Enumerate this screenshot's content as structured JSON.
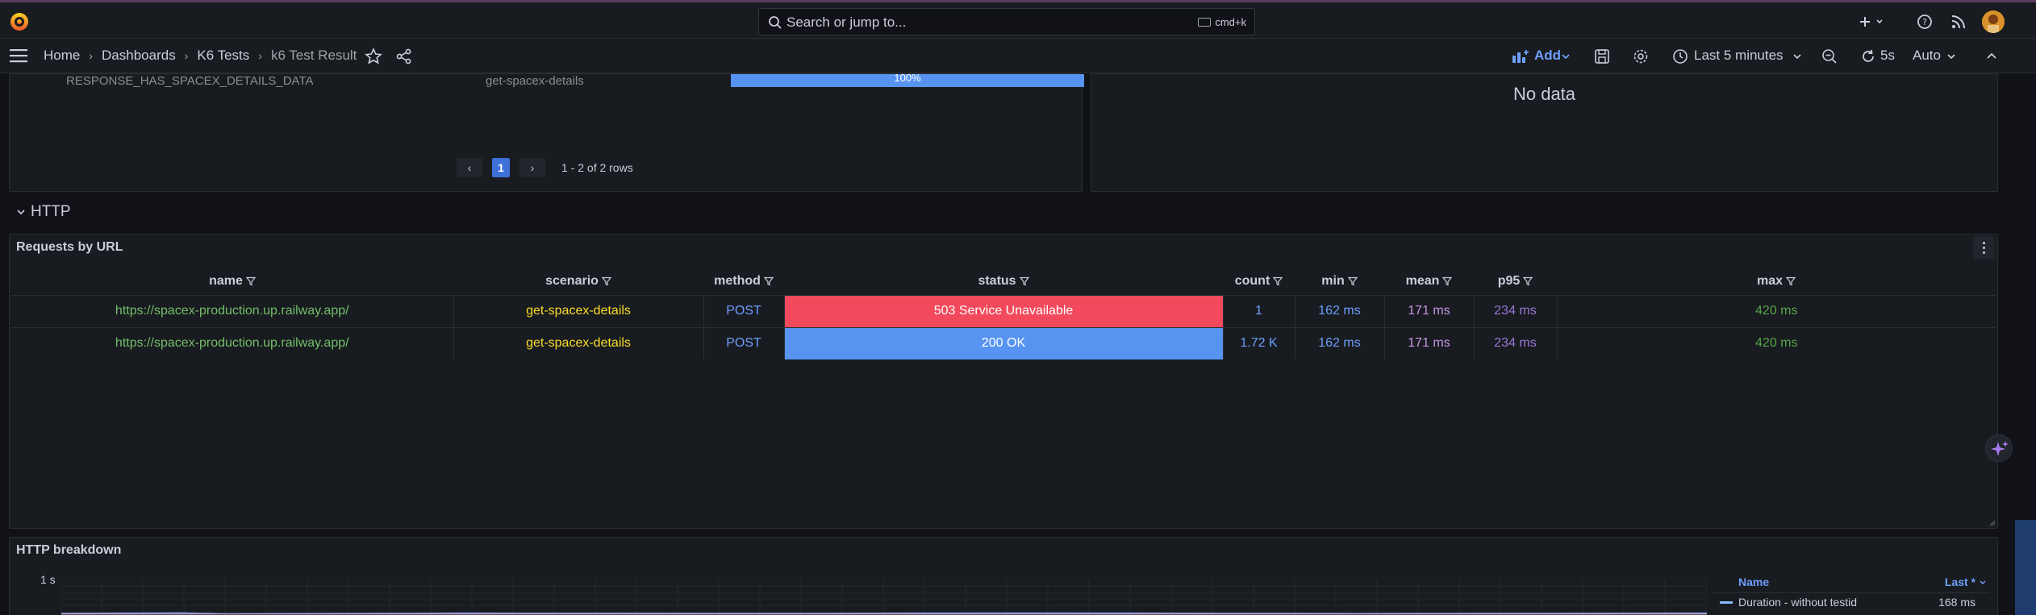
{
  "topbar": {
    "search_placeholder": "Search or jump to...",
    "search_shortcut": "cmd+k"
  },
  "nav": {
    "breadcrumbs": [
      "Home",
      "Dashboards",
      "K6 Tests",
      "k6 Test Result"
    ],
    "add_label": "Add",
    "time_range": "Last 5 minutes",
    "refresh_interval": "5s",
    "mode": "Auto"
  },
  "top_panels": {
    "cutoff_row_left": "RESPONSE_HAS_SPACEX_DETAILS_DATA",
    "cutoff_row_mid": "get-spacex-details",
    "cutoff_row_bar": "100%",
    "pager_current": "1",
    "pager_info": "1 - 2 of 2 rows",
    "right_panel_text": "No data"
  },
  "section": {
    "title": "HTTP"
  },
  "requests_panel": {
    "title": "Requests by URL",
    "columns": [
      "name",
      "scenario",
      "method",
      "status",
      "count",
      "min",
      "mean",
      "p95",
      "max"
    ],
    "rows": [
      {
        "name": "https://spacex-production.up.railway.app/",
        "scenario": "get-spacex-details",
        "method": "POST",
        "status": "503 Service Unavailable",
        "count": "1",
        "min": "162 ms",
        "mean": "171 ms",
        "p95": "234 ms",
        "max": "420 ms"
      },
      {
        "name": "https://spacex-production.up.railway.app/",
        "scenario": "get-spacex-details",
        "method": "POST",
        "status": "200 OK",
        "count": "1.72 K",
        "min": "162 ms",
        "mean": "171 ms",
        "p95": "234 ms",
        "max": "420 ms"
      }
    ]
  },
  "breakdown_panel": {
    "title": "HTTP breakdown",
    "y_tick": "1 s",
    "legend_name_header": "Name",
    "legend_last_header": "Last *",
    "legend_series": [
      {
        "name": "Duration - without testid",
        "last": "168 ms",
        "color": "#8ab8ff"
      }
    ]
  },
  "colors": {
    "status_error": "#f2495c",
    "status_ok": "#5794f2",
    "accent": "#6e9fff"
  }
}
